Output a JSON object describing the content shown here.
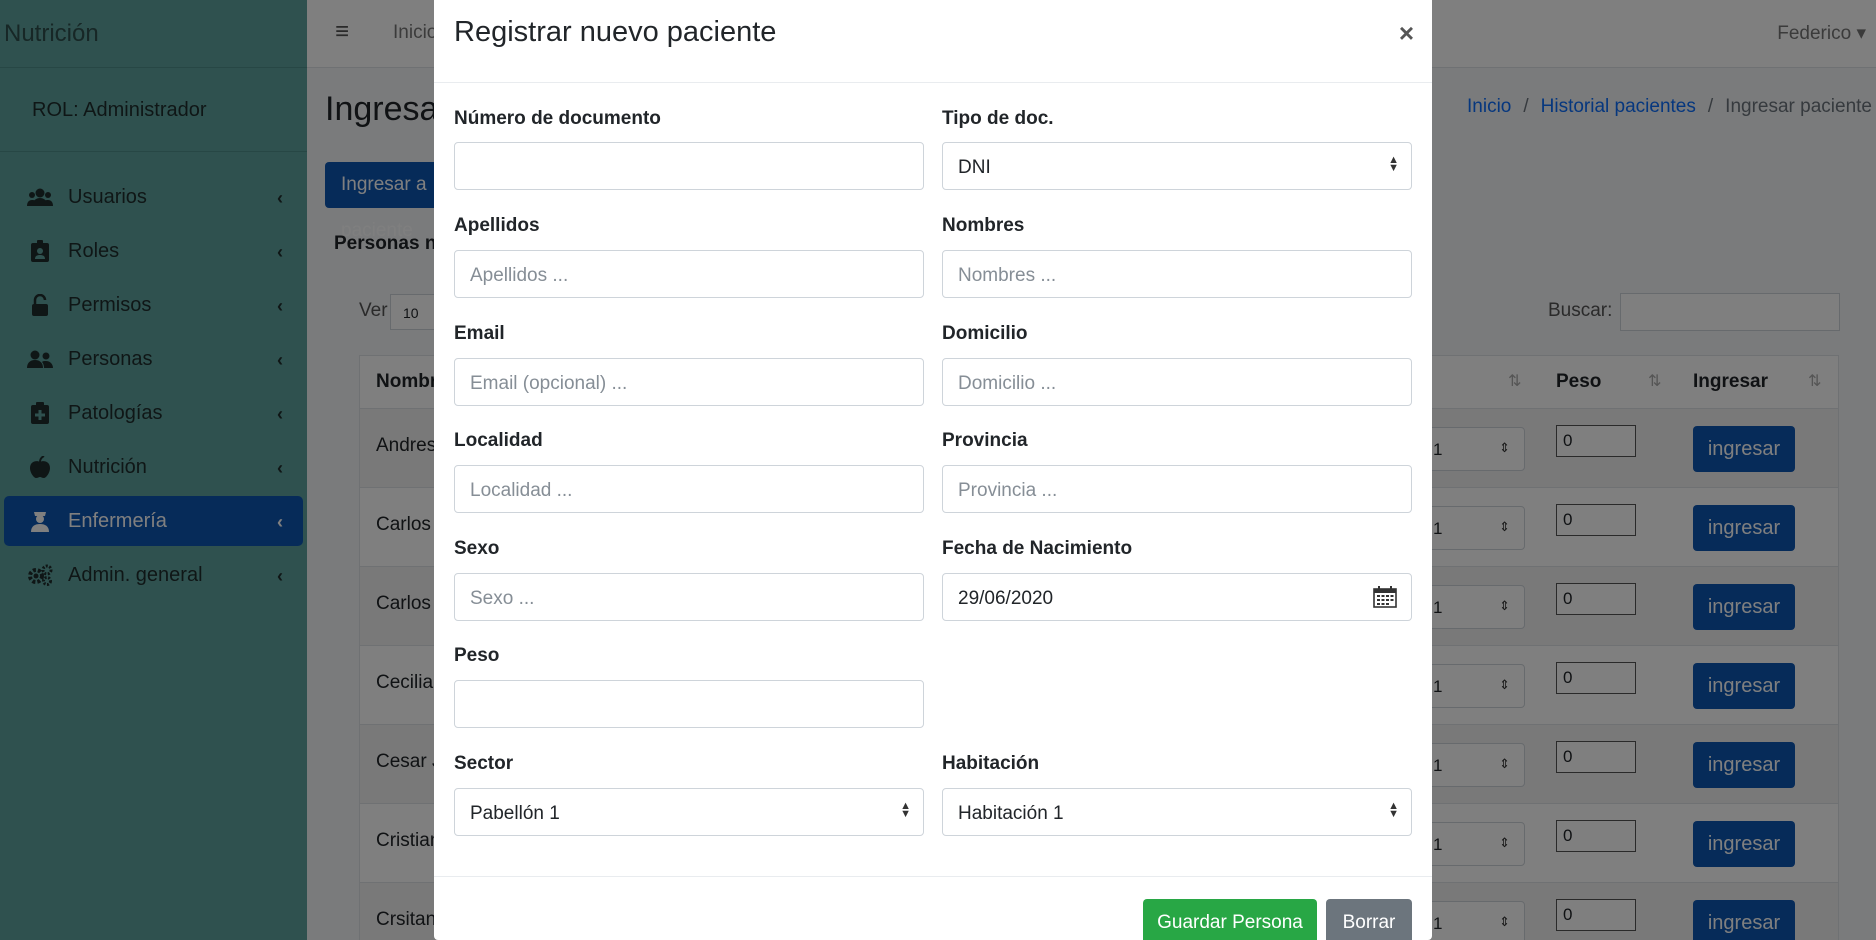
{
  "sidebar": {
    "brand": "Nutrición",
    "role": "ROL: Administrador",
    "items": [
      {
        "label": "Usuarios",
        "icon": "users-icon"
      },
      {
        "label": "Roles",
        "icon": "id-badge-icon"
      },
      {
        "label": "Permisos",
        "icon": "unlock-icon"
      },
      {
        "label": "Personas",
        "icon": "user-friends-icon"
      },
      {
        "label": "Patologías",
        "icon": "medical-file-icon"
      },
      {
        "label": "Nutrición",
        "icon": "apple-icon"
      },
      {
        "label": "Enfermería",
        "icon": "nurse-icon"
      },
      {
        "label": "Admin. general",
        "icon": "gears-icon"
      }
    ]
  },
  "topbar": {
    "inicio": "Inicio",
    "user": "Federico"
  },
  "page": {
    "title": "Ingresar paciente",
    "breadcrumb": [
      "Inicio",
      "Historial pacientes",
      "Ingresar paciente"
    ],
    "add_button": "Ingresar a paciente",
    "section_label": "Personas no ingresadas",
    "ver_label": "Ver",
    "ver_value": "10",
    "search_label": "Buscar:"
  },
  "table": {
    "headers": [
      "Nombre",
      "Peso",
      "Ingresar"
    ],
    "rows": [
      {
        "name": "Andres",
        "hab": "1",
        "peso": "0",
        "action": "ingresar"
      },
      {
        "name": "Carlos",
        "hab": "1",
        "peso": "0",
        "action": "ingresar"
      },
      {
        "name": "Carlos",
        "hab": "1",
        "peso": "0",
        "action": "ingresar"
      },
      {
        "name": "Cecilia",
        "hab": "1",
        "peso": "0",
        "action": "ingresar"
      },
      {
        "name": "Cesar J",
        "hab": "1",
        "peso": "0",
        "action": "ingresar"
      },
      {
        "name": "Cristian",
        "hab": "1",
        "peso": "0",
        "action": "ingresar"
      },
      {
        "name": "Crsitan",
        "hab": "1",
        "peso": "0",
        "action": "ingresar"
      }
    ]
  },
  "modal": {
    "title": "Registrar nuevo paciente",
    "close": "×",
    "fields": {
      "documento": {
        "label": "Número de documento",
        "value": "",
        "placeholder": ""
      },
      "tipo_doc": {
        "label": "Tipo de doc.",
        "value": "DNI"
      },
      "apellidos": {
        "label": "Apellidos",
        "placeholder": "Apellidos ..."
      },
      "nombres": {
        "label": "Nombres",
        "placeholder": "Nombres ..."
      },
      "email": {
        "label": "Email",
        "placeholder": "Email (opcional) ..."
      },
      "domicilio": {
        "label": "Domicilio",
        "placeholder": "Domicilio ..."
      },
      "localidad": {
        "label": "Localidad",
        "placeholder": "Localidad ..."
      },
      "provincia": {
        "label": "Provincia",
        "placeholder": "Provincia ..."
      },
      "sexo": {
        "label": "Sexo",
        "placeholder": "Sexo ..."
      },
      "fecha_nac": {
        "label": "Fecha de Nacimiento",
        "value": "29/06/2020"
      },
      "peso": {
        "label": "Peso",
        "value": ""
      },
      "sector": {
        "label": "Sector",
        "value": "Pabellón 1"
      },
      "habitacion": {
        "label": "Habitación",
        "value": "Habitación 1"
      }
    },
    "save_button": "Guardar Persona",
    "reset_button": "Borrar"
  }
}
